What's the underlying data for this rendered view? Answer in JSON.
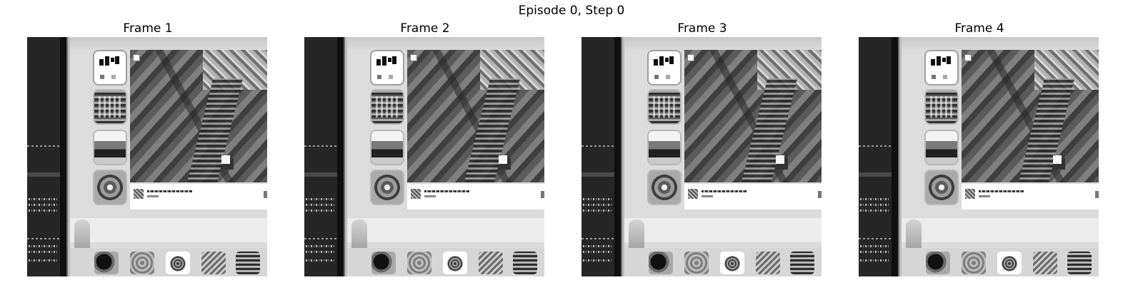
{
  "figure": {
    "title": "Episode 0, Step 0"
  },
  "frames": [
    {
      "label": "Frame 1"
    },
    {
      "label": "Frame 2"
    },
    {
      "label": "Frame 3"
    },
    {
      "label": "Frame 4"
    }
  ],
  "colors": {
    "background": "#ffffff",
    "frame_dark": "#262626",
    "frame_light": "#dcdcdc"
  }
}
